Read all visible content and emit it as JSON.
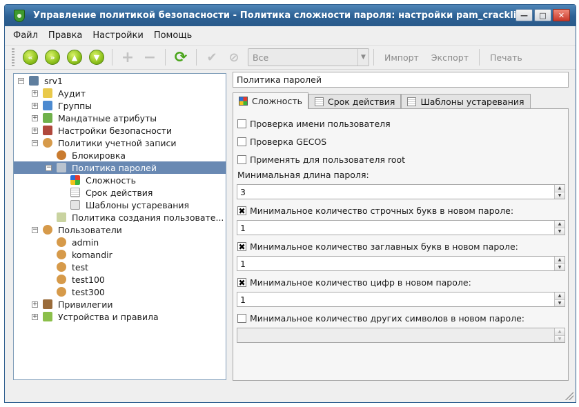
{
  "window": {
    "title": "Управление политикой безопасности - Политика сложности пароля: настройки pam_cracklib"
  },
  "menu": [
    "Файл",
    "Правка",
    "Настройки",
    "Помощь"
  ],
  "toolbar": {
    "filter_value": "Все",
    "import_label": "Импорт",
    "export_label": "Экспорт",
    "print_label": "Печать"
  },
  "tree": {
    "root": "srv1",
    "audit": "Аудит",
    "groups": "Группы",
    "mandatory": "Мандатные атрибуты",
    "security_settings": "Настройки безопасности",
    "account_policies": "Политики учетной записи",
    "lockout": "Блокировка",
    "password_policy": "Политика паролей",
    "complexity": "Сложность",
    "validity": "Срок действия",
    "aging_templates": "Шаблоны устаревания",
    "user_creation_policy": "Политика создания пользовате...",
    "users": "Пользователи",
    "user1": "admin",
    "user2": "komandir",
    "user3": "test",
    "user4": "test100",
    "user5": "test300",
    "privileges": "Привилегии",
    "devices": "Устройства и правила"
  },
  "panel": {
    "section_title": "Политика паролей",
    "tabs": [
      "Сложность",
      "Срок действия",
      "Шаблоны устаревания"
    ],
    "check_username": "Проверка имени пользователя",
    "check_gecos": "Проверка GECOS",
    "apply_root": "Применять для пользователя root",
    "min_length_label": "Минимальная длина пароля:",
    "min_length_value": "3",
    "min_lower_label": "Минимальное количество строчных букв в новом пароле:",
    "min_lower_value": "1",
    "min_upper_label": "Минимальное количество заглавных букв в новом пароле:",
    "min_upper_value": "1",
    "min_digits_label": "Минимальное количество цифр в новом пароле:",
    "min_digits_value": "1",
    "min_other_label": "Минимальное количество других символов в новом пароле:",
    "min_other_value": ""
  }
}
